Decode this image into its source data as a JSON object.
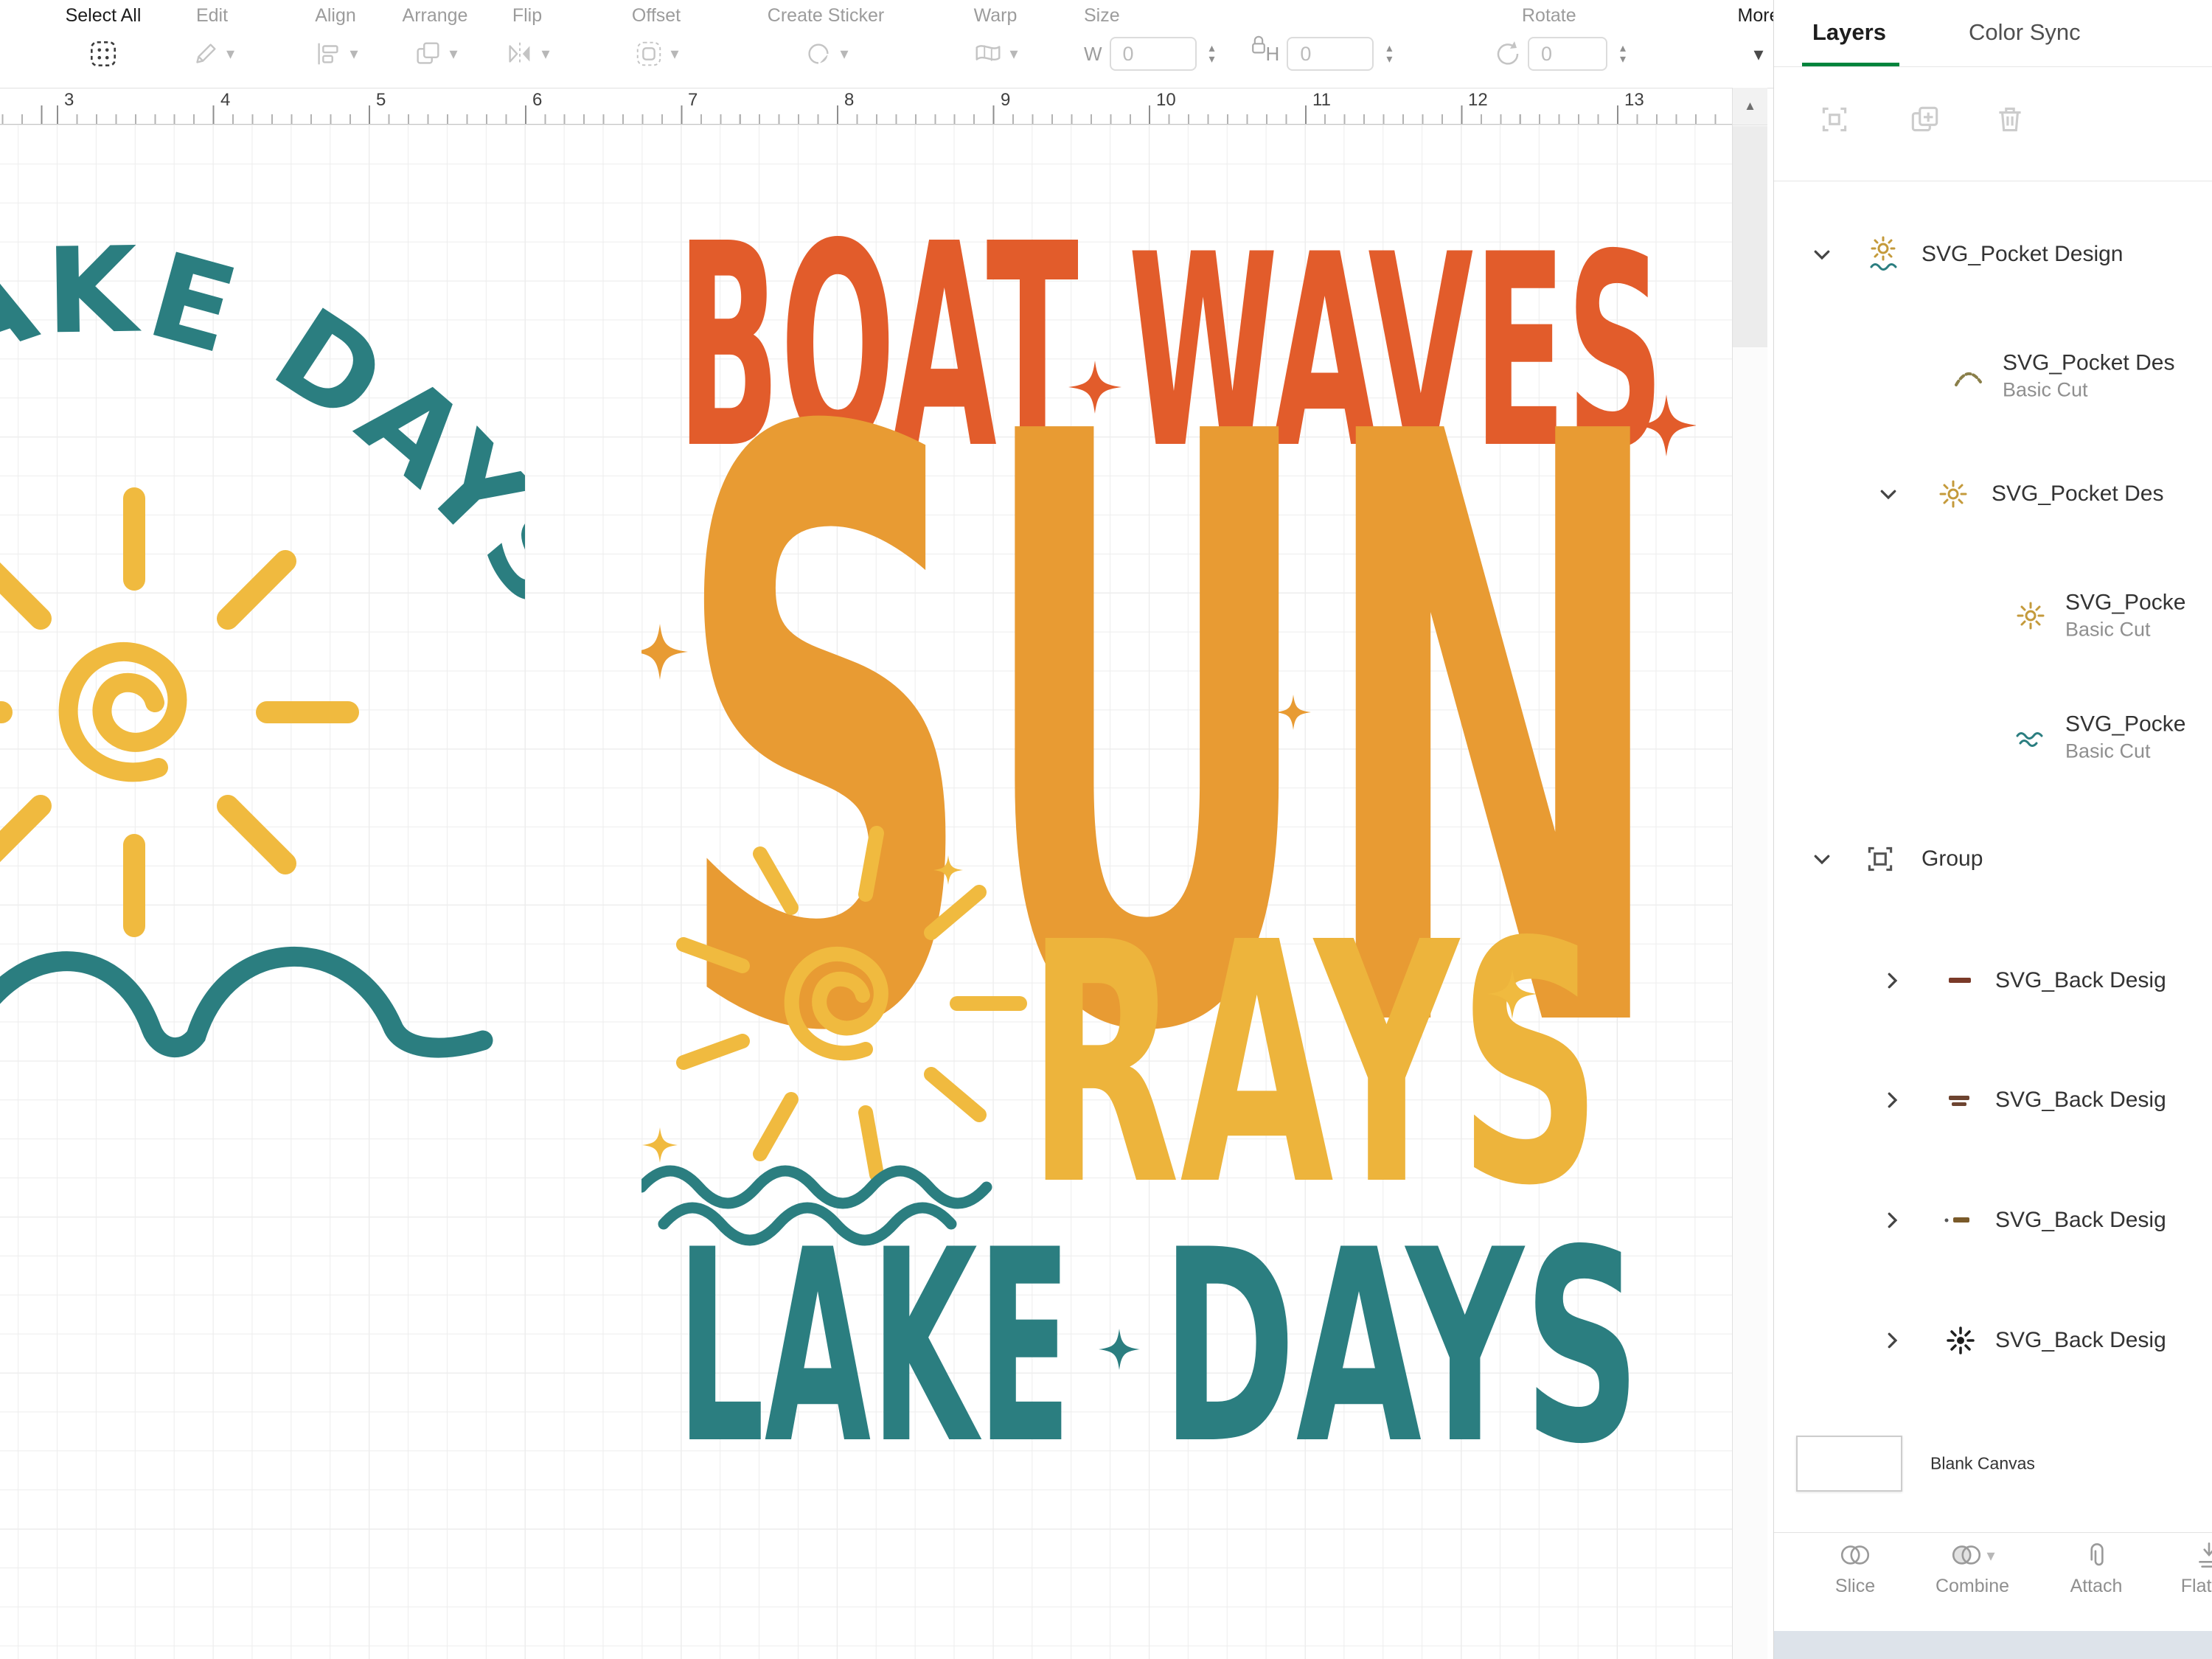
{
  "colors": {
    "accent_green": "#00843D",
    "orange": "#E25C2B",
    "orange_gold": "#E89B33",
    "yellow": "#EDB43C",
    "yellow_bright": "#F0BA3F",
    "teal": "#2B7E80"
  },
  "toolbar": {
    "select_all": "Select All",
    "edit": "Edit",
    "align": "Align",
    "arrange": "Arrange",
    "flip": "Flip",
    "offset": "Offset",
    "create_sticker": "Create Sticker",
    "warp": "Warp",
    "size_label": "Size",
    "w_label": "W",
    "w_value": "0",
    "h_label": "H",
    "h_value": "0",
    "rotate_label": "Rotate",
    "rotate_value": "0",
    "more_label": "More"
  },
  "ruler": {
    "numbers": [
      "3",
      "4",
      "5",
      "6",
      "7",
      "8",
      "9",
      "10",
      "11",
      "12",
      "13"
    ]
  },
  "design": {
    "word_boat": "BOAT",
    "word_waves": "WAVES",
    "word_sun": "SUN",
    "word_rays": "RAYS",
    "word_lake": "LAKE",
    "word_days": "DAYS",
    "arc_text": "LAKE DAYS"
  },
  "panel": {
    "tab_layers": "Layers",
    "tab_color_sync": "Color Sync",
    "layers": [
      {
        "label": "SVG_Pocket Design",
        "sub": ""
      },
      {
        "label": "SVG_Pocket Des",
        "sub": "Basic Cut"
      },
      {
        "label": "SVG_Pocket Des",
        "sub": ""
      },
      {
        "label": "SVG_Pocke",
        "sub": "Basic Cut"
      },
      {
        "label": "SVG_Pocke",
        "sub": "Basic Cut"
      },
      {
        "label": "Group",
        "sub": ""
      },
      {
        "label": "SVG_Back Desig",
        "sub": ""
      },
      {
        "label": "SVG_Back Desig",
        "sub": ""
      },
      {
        "label": "SVG_Back Desig",
        "sub": ""
      },
      {
        "label": "SVG_Back Desig",
        "sub": ""
      }
    ],
    "blank_canvas_label": "Blank Canvas",
    "actions": [
      {
        "label": "Slice"
      },
      {
        "label": "Combine"
      },
      {
        "label": "Attach"
      },
      {
        "label": "Flatten"
      }
    ]
  }
}
